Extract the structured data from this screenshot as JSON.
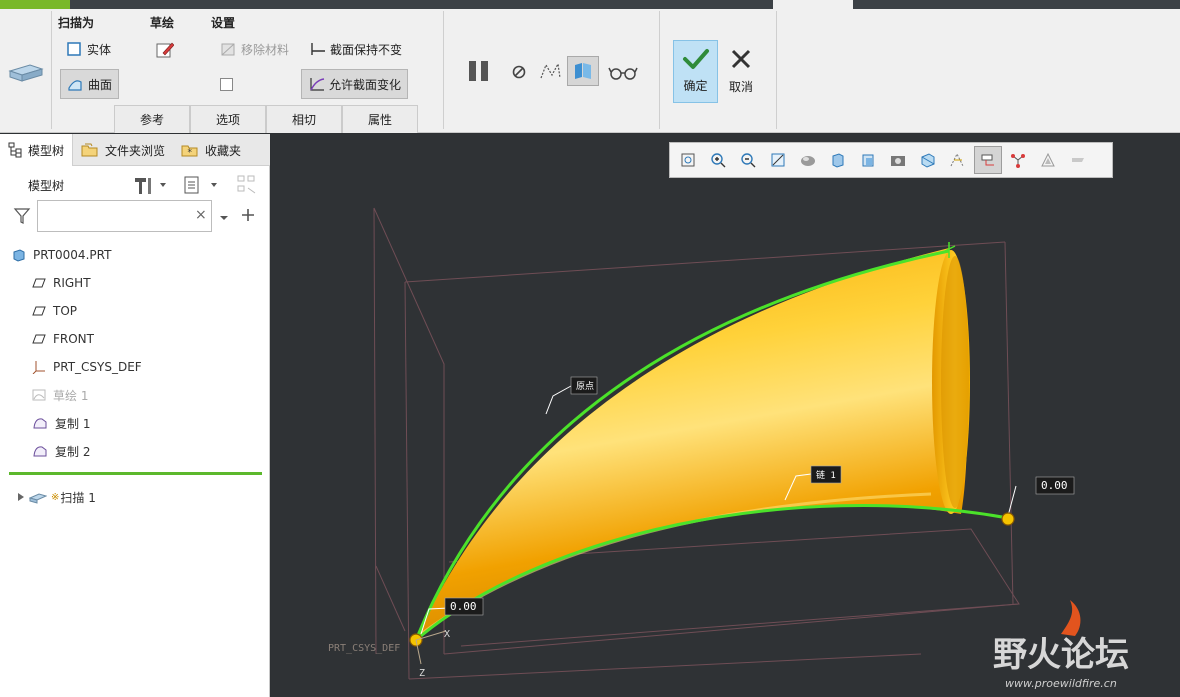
{
  "ribbon": {
    "groups": {
      "sweep_as": "扫描为",
      "sketch": "草绘",
      "settings": "设置"
    },
    "solid_label": "实体",
    "surface_label": "曲面",
    "remove_material_label": "移除材料",
    "keep_section_label": "截面保持不变",
    "allow_section_change_label": "允许截面变化",
    "ok_label": "确定",
    "cancel_label": "取消",
    "tabs": [
      {
        "label": "参考"
      },
      {
        "label": "选项"
      },
      {
        "label": "相切"
      },
      {
        "label": "属性"
      }
    ]
  },
  "left_panel": {
    "tabs": [
      {
        "label": "模型树"
      },
      {
        "label": "文件夹浏览"
      },
      {
        "label": "收藏夹"
      }
    ],
    "tree_header": "模型树",
    "search": {
      "value": "",
      "placeholder": ""
    },
    "tree": [
      {
        "label": "PRT0004.PRT",
        "icon": "part-icon"
      },
      {
        "label": "RIGHT",
        "icon": "datum-plane-icon"
      },
      {
        "label": "TOP",
        "icon": "datum-plane-icon"
      },
      {
        "label": "FRONT",
        "icon": "datum-plane-icon"
      },
      {
        "label": "PRT_CSYS_DEF",
        "icon": "csys-icon"
      },
      {
        "label": "草绘 1",
        "icon": "sketch-icon"
      },
      {
        "label": "复制 1",
        "icon": "copy-surface-icon"
      },
      {
        "label": "复制 2",
        "icon": "copy-surface-icon"
      }
    ],
    "sweep_item": {
      "label": "扫描 1",
      "marker": "※"
    }
  },
  "viewport": {
    "labels": {
      "origin": "原点",
      "chain1": "链 1",
      "value_right": "0.00",
      "value_left": "0.00",
      "csys": "PRT_CSYS_DEF",
      "axis_x": "X",
      "axis_z": "Z"
    },
    "colors": {
      "background": "#2f3235",
      "surface": "#f2a400",
      "trajectory": "#4be22a",
      "point": "#f5c400"
    }
  },
  "watermark": {
    "title": "野火论坛",
    "url": "www.proewildfire.cn"
  }
}
